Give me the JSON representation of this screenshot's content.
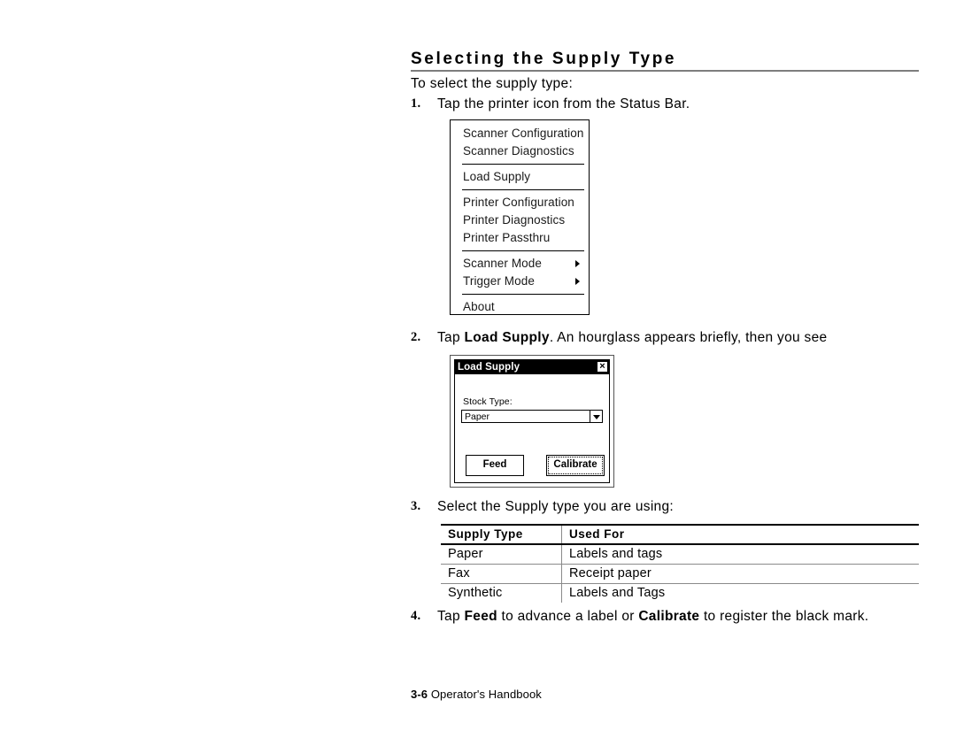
{
  "heading": "Selecting the Supply Type",
  "intro": "To select the supply type:",
  "steps": [
    {
      "num": "1.",
      "text_plain": "Tap the printer icon from the Status Bar."
    },
    {
      "num": "2.",
      "text_plain": "Tap Load Supply.  An hourglass appears briefly, then you see"
    },
    {
      "num": "3.",
      "text_plain": "Select the Supply type you are using:"
    },
    {
      "num": "4.",
      "text_plain": "Tap Feed to advance a label or Calibrate to register the black mark."
    }
  ],
  "step2_parts": {
    "before": "Tap ",
    "bold": "Load Supply",
    "after": ".  An hourglass appears briefly, then you see"
  },
  "step4_parts": {
    "a": "Tap ",
    "b1": "Feed",
    "b": " to advance a label or ",
    "b2": "Calibrate",
    "c": " to register the black mark."
  },
  "menu": {
    "groups": [
      {
        "items": [
          {
            "label": "Scanner Configuration",
            "submenu": false
          },
          {
            "label": "Scanner Diagnostics",
            "submenu": false
          }
        ]
      },
      {
        "items": [
          {
            "label": "Load Supply",
            "submenu": false
          }
        ]
      },
      {
        "items": [
          {
            "label": "Printer Configuration",
            "submenu": false
          },
          {
            "label": "Printer Diagnostics",
            "submenu": false
          },
          {
            "label": "Printer Passthru",
            "submenu": false
          }
        ]
      },
      {
        "items": [
          {
            "label": "Scanner Mode",
            "submenu": true
          },
          {
            "label": "Trigger Mode",
            "submenu": true
          }
        ]
      },
      {
        "items": [
          {
            "label": "About",
            "submenu": false
          }
        ]
      }
    ]
  },
  "dialog": {
    "title": "Load Supply",
    "close_glyph": "×",
    "stock_type_label": "Stock Type:",
    "stock_type_value": "Paper",
    "stock_type_options": [
      "Paper"
    ],
    "feed_button": "Feed",
    "calibrate_button": "Calibrate"
  },
  "table": {
    "headers": [
      "Supply Type",
      "Used For"
    ],
    "rows": [
      [
        "Paper",
        "Labels and tags"
      ],
      [
        "Fax",
        "Receipt paper"
      ],
      [
        "Synthetic",
        "Labels and Tags"
      ]
    ]
  },
  "footer": {
    "page_number": "3-6",
    "book_title": "Operator's Handbook"
  }
}
